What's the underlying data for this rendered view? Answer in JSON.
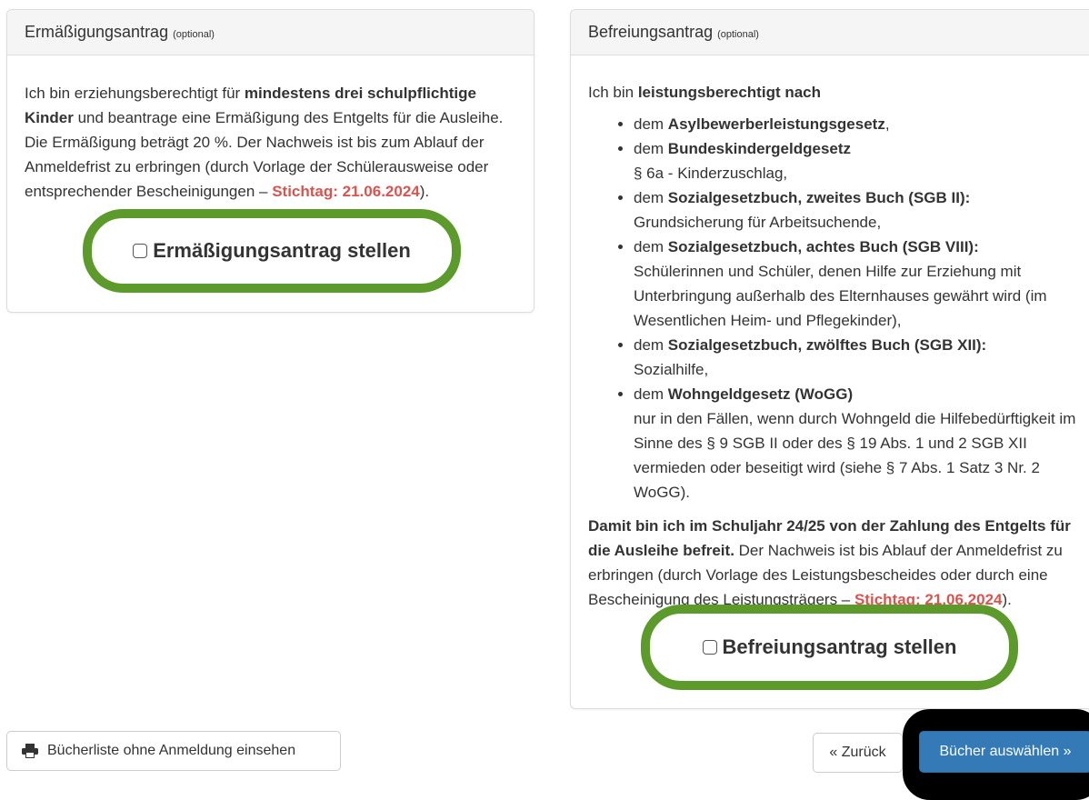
{
  "reduction": {
    "title": "Ermäßigungsantrag",
    "optional": "(optional)",
    "text_1": "Ich bin erziehungsberechtigt für ",
    "text_bold": "mindestens drei schulpflichtige Kinder",
    "text_2": " und beantrage eine Ermäßigung des Entgelts für die Ausleihe. Die Ermäßigung beträgt 20 %. Der Nachweis ist bis zum Ablauf der Anmeldefrist zu erbringen (durch Vorlage der Schülerausweise oder entsprechender Bescheinigungen – ",
    "deadline": "Stichtag: 21.06.2024",
    "text_end": ").",
    "checkbox_label": "Ermäßigungsantrag stellen",
    "checked": false
  },
  "exemption": {
    "title": "Befreiungsantrag",
    "optional": "(optional)",
    "intro_1": "Ich bin ",
    "intro_bold": "leistungsberechtigt nach",
    "items": [
      {
        "prefix": "dem ",
        "bold": "Asylbewerberleistungsgesetz",
        "rest": ","
      },
      {
        "prefix": "dem ",
        "bold": "Bundeskindergeldgesetz",
        "rest": "§ 6a - Kinderzuschlag,"
      },
      {
        "prefix": "dem ",
        "bold": "Sozialgesetzbuch, zweites Buch (SGB II):",
        "rest": "Grundsicherung für Arbeitsuchende,"
      },
      {
        "prefix": "dem ",
        "bold": "Sozialgesetzbuch, achtes Buch (SGB VIII):",
        "rest": "Schülerinnen und Schüler, denen Hilfe zur Erziehung mit Unterbringung außerhalb des Elternhauses gewährt wird (im Wesentlichen Heim- und Pflegekinder),"
      },
      {
        "prefix": "dem ",
        "bold": "Sozialgesetzbuch, zwölftes Buch (SGB XII):",
        "rest": "Sozialhilfe,"
      },
      {
        "prefix": "dem ",
        "bold": "Wohngeldgesetz (WoGG)",
        "rest": "nur in den Fällen, wenn durch Wohngeld die Hilfebedürftigkeit im Sinne des § 9 SGB II oder des § 19 Abs. 1 und 2 SGB XII vermieden oder beseitigt wird (siehe § 7 Abs. 1 Satz 3 Nr. 2 WoGG)."
      }
    ],
    "summary_bold": "Damit bin ich im Schuljahr 24/25 von der Zahlung des Entgelts für die Ausleihe befreit.",
    "summary_text": " Der Nachweis ist bis Ablauf der Anmeldefrist zu erbringen (durch Vorlage des Leistungsbescheides oder durch eine Bescheinigung des Leistungsträgers – ",
    "deadline": "Stichtag: 21.06.2024",
    "text_end": ").",
    "checkbox_label": "Befreiungsantrag stellen",
    "checked": false
  },
  "footer": {
    "booklist_label": "Bücherliste ohne Anmeldung einsehen",
    "booklist_icon": "printer-icon",
    "back_label": "« Zurück",
    "next_label": "Bücher auswählen »"
  },
  "colors": {
    "highlight_green": "#5c9a2b",
    "deadline_red": "#d9534f",
    "primary_blue": "#337ab7"
  }
}
